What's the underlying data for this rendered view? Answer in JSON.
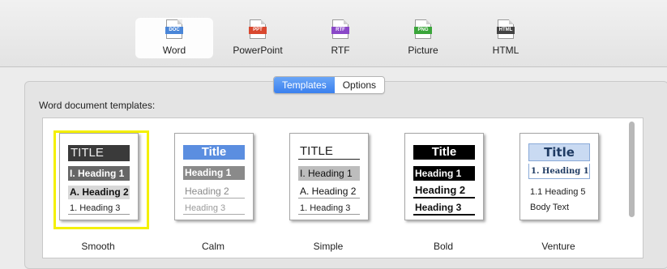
{
  "formats": [
    {
      "label": "Word",
      "tag": "DOC",
      "color": "#4a86d8",
      "icon": "word-document-icon",
      "selected": true
    },
    {
      "label": "PowerPoint",
      "tag": "PPT",
      "color": "#d9482f",
      "icon": "powerpoint-document-icon",
      "selected": false
    },
    {
      "label": "RTF",
      "tag": "RTF",
      "color": "#8a48c8",
      "icon": "rtf-document-icon",
      "selected": false
    },
    {
      "label": "Picture",
      "tag": "PNG",
      "color": "#3aa53a",
      "icon": "png-document-icon",
      "selected": false
    },
    {
      "label": "HTML",
      "tag": "HTML",
      "color": "#444444",
      "icon": "html-document-icon",
      "selected": false
    }
  ],
  "tabs": {
    "templates": "Templates",
    "options": "Options",
    "active": "templates"
  },
  "section_label": "Word document templates:",
  "selection_color": "#f4f000",
  "templates": [
    {
      "name": "Smooth",
      "selected": true,
      "title": "TITLE",
      "h1": "I. Heading 1",
      "h2": "A. Heading 2",
      "h3": "1. Heading 3"
    },
    {
      "name": "Calm",
      "selected": false,
      "title": "Title",
      "h1": "Heading 1",
      "h2": "Heading 2",
      "h3": "Heading 3"
    },
    {
      "name": "Simple",
      "selected": false,
      "title": "TITLE",
      "h1": "I. Heading 1",
      "h2": "A. Heading 2",
      "h3": "1. Heading 3"
    },
    {
      "name": "Bold",
      "selected": false,
      "title": "Title",
      "h1": "Heading 1",
      "h2": "Heading 2",
      "h3": "Heading 3"
    },
    {
      "name": "Venture",
      "selected": false,
      "title": "Title",
      "h1": "1. Heading 1",
      "h2": "1.1 Heading 5",
      "h3": "Body Text"
    }
  ]
}
